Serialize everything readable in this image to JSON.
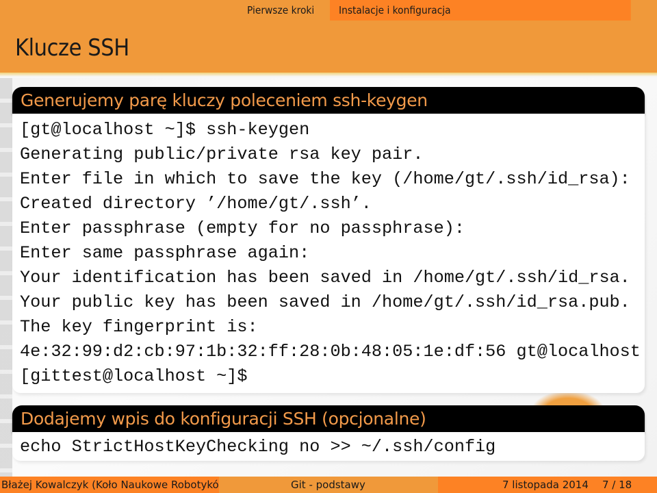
{
  "header": {
    "nav": [
      {
        "label": "Pierwsze kroki",
        "active": false
      },
      {
        "label": "Instalacje i konfiguracja",
        "active": true
      }
    ],
    "title": "Klucze SSH"
  },
  "blocks": [
    {
      "title": "Generujemy parę kluczy poleceniem ssh-keygen",
      "lines": [
        "[gt@localhost ~]$ ssh-keygen",
        "Generating public/private rsa key pair.",
        "Enter file in which to save the key (/home/gt/.ssh/id_rsa):",
        "Created directory ’/home/gt/.ssh’.",
        "Enter passphrase (empty for no passphrase):",
        "Enter same passphrase again:",
        "Your identification has been saved in /home/gt/.ssh/id_rsa.",
        "Your public key has been saved in /home/gt/.ssh/id_rsa.pub.",
        "The key fingerprint is:",
        "4e:32:99:d2:cb:97:1b:32:ff:28:0b:48:05:1e:df:56 gt@localhost",
        "[gittest@localhost ~]$"
      ]
    },
    {
      "title": "Dodajemy wpis do konfiguracji SSH (opcjonalne)",
      "lines": [
        "echo StrictHostKeyChecking no >> ~/.ssh/config"
      ]
    }
  ],
  "footer": {
    "author": "Błażej Kowalczyk (Koło Naukowe Robotykó",
    "talk": "Git - podstawy",
    "date": "7 listopada 2014",
    "page": "7 / 18"
  },
  "colors": {
    "header_orange": "#f0993a",
    "active_orange": "#fd8224",
    "block_title_text": "#f29a4a",
    "block_title_bg": "#000000"
  }
}
